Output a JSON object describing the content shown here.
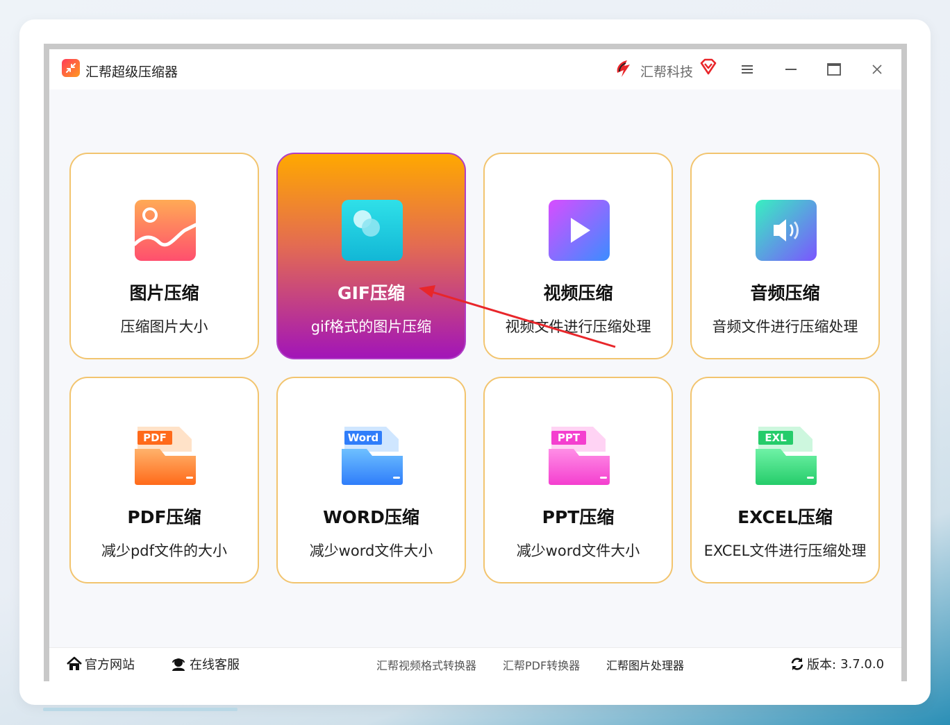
{
  "app": {
    "title": "汇帮超级压缩器",
    "brand": "汇帮科技"
  },
  "cards": [
    {
      "title": "图片压缩",
      "desc": "压缩图片大小",
      "icon": "image-icon"
    },
    {
      "title": "GIF压缩",
      "desc": "gif格式的图片压缩",
      "icon": "gif-icon",
      "selected": true
    },
    {
      "title": "视频压缩",
      "desc": "视频文件进行压缩处理",
      "icon": "video-play-icon"
    },
    {
      "title": "音频压缩",
      "desc": "音频文件进行压缩处理",
      "icon": "audio-speaker-icon"
    },
    {
      "title": "PDF压缩",
      "desc": "减少pdf文件的大小",
      "icon": "pdf-folder-icon",
      "badge": "PDF"
    },
    {
      "title": "WORD压缩",
      "desc": "减少word文件大小",
      "icon": "word-folder-icon",
      "badge": "Word"
    },
    {
      "title": "PPT压缩",
      "desc": "减少word文件大小",
      "icon": "ppt-folder-icon",
      "badge": "PPT"
    },
    {
      "title": "EXCEL压缩",
      "desc": "EXCEL文件进行压缩处理",
      "icon": "excel-folder-icon",
      "badge": "EXL"
    }
  ],
  "footer": {
    "website": "官方网站",
    "support": "在线客服",
    "links": [
      "汇帮视频格式转换器",
      "汇帮PDF转换器",
      "汇帮图片处理器"
    ],
    "version_label": "版本:",
    "version": "3.7.0.0"
  },
  "colors": {
    "card_border": "#f2c46e",
    "active_gradient": [
      "#ffa800",
      "#e36b52",
      "#a215b8"
    ],
    "annotation_arrow": "#e8262a"
  }
}
